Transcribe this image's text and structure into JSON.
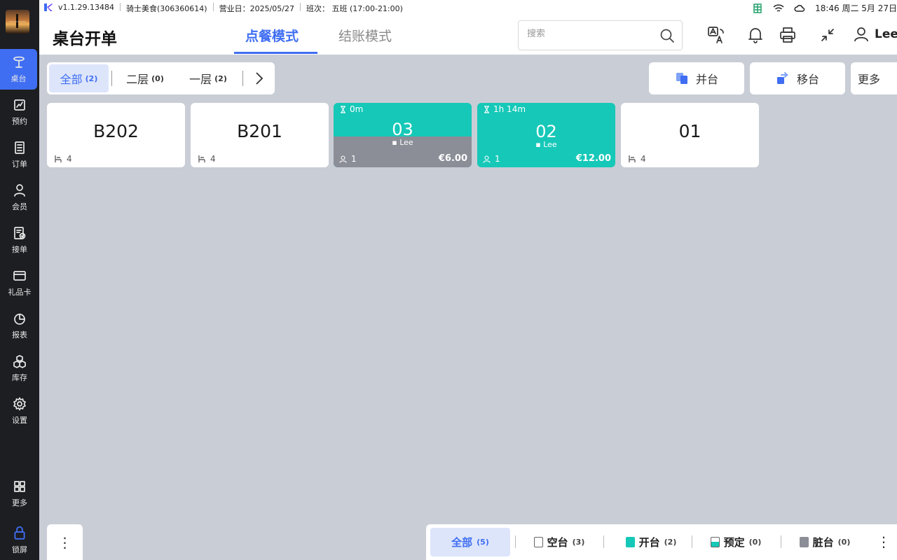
{
  "status_bar": {
    "version": "v1.1.29.13484",
    "store": "骑士美食(306360614)",
    "business_day": "营业日：2025/05/27",
    "shift": "班次：   五班 (17:00-21:00)",
    "clock": "18:46 周二 5月 27日"
  },
  "sidebar": {
    "items": [
      {
        "label": "桌台",
        "icon": "table-icon"
      },
      {
        "label": "预约",
        "icon": "reservation-icon"
      },
      {
        "label": "订单",
        "icon": "order-icon"
      },
      {
        "label": "会员",
        "icon": "member-icon"
      },
      {
        "label": "接单",
        "icon": "accept-order-icon"
      },
      {
        "label": "礼品卡",
        "icon": "gift-card-icon"
      },
      {
        "label": "报表",
        "icon": "report-icon"
      },
      {
        "label": "库存",
        "icon": "inventory-icon"
      },
      {
        "label": "设置",
        "icon": "settings-icon"
      },
      {
        "label": "更多",
        "icon": "more-grid-icon"
      },
      {
        "label": "锁屏",
        "icon": "lock-icon"
      }
    ]
  },
  "header": {
    "title": "桌台开单",
    "tabs": [
      {
        "label": "点餐模式",
        "active": true
      },
      {
        "label": "结账模式",
        "active": false
      }
    ],
    "search_placeholder": "搜索",
    "user": "Lee"
  },
  "floors": [
    {
      "label": "全部",
      "count": "(2)",
      "active": true
    },
    {
      "label": "二层",
      "count": "(0)",
      "active": false
    },
    {
      "label": "一层",
      "count": "(2)",
      "active": false
    }
  ],
  "actions": {
    "merge": "并台",
    "move": "移台",
    "more": "更多"
  },
  "tables": [
    {
      "name": "B202",
      "status": "empty",
      "seats": "4"
    },
    {
      "name": "B201",
      "status": "empty",
      "seats": "4"
    },
    {
      "name": "03",
      "status": "dirty",
      "timer": "0m",
      "waiter": "Lee",
      "guests": "1",
      "amount": "€6.00"
    },
    {
      "name": "02",
      "status": "open",
      "timer": "1h 14m",
      "waiter": "Lee",
      "guests": "1",
      "amount": "€12.00"
    },
    {
      "name": "01",
      "status": "empty",
      "seats": "4"
    }
  ],
  "legend": [
    {
      "label": "全部",
      "count": "(5)",
      "active": true
    },
    {
      "label": "空台",
      "count": "(3)",
      "color": "#ffffff"
    },
    {
      "label": "开台",
      "count": "(2)",
      "color": "#16c8b8"
    },
    {
      "label": "预定",
      "count": "(0)",
      "color": "#16c8b8"
    },
    {
      "label": "脏台",
      "count": "(0)",
      "color": "#8b8d97"
    }
  ],
  "colors": {
    "accent": "#3f6ef2",
    "open": "#16c8b8",
    "dirty": "#8b8d97",
    "sidebar": "#1d1e22"
  }
}
